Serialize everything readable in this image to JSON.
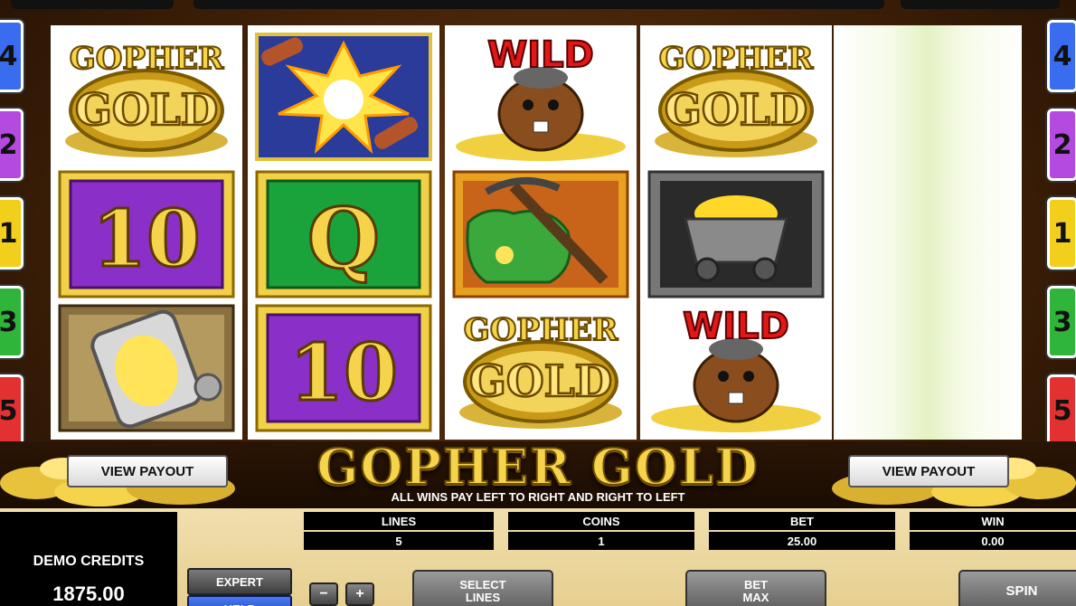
{
  "game": {
    "logo_text": "GOPHER GOLD",
    "subtitle": "ALL WINS PAY LEFT TO RIGHT AND RIGHT TO LEFT",
    "view_payout_left": "VIEW PAYOUT",
    "view_payout_right": "VIEW PAYOUT"
  },
  "line_markers": {
    "left": [
      "4",
      "2",
      "1",
      "3",
      "5"
    ],
    "right": [
      "4",
      "2",
      "1",
      "3",
      "5"
    ],
    "colors": [
      "#3a6cf0",
      "#b44ae0",
      "#f2cf1a",
      "#2fb53a",
      "#e33030"
    ]
  },
  "reels": [
    [
      "gopher-gold-logo",
      "ten",
      "lantern"
    ],
    [
      "dynamite-explosion",
      "queen",
      "ten"
    ],
    [
      "wild-gopher",
      "pickaxe-bag",
      "gopher-gold-logo"
    ],
    [
      "gopher-gold-logo",
      "gold-mine-cart",
      "wild-gopher"
    ]
  ],
  "symbols": {
    "gopher_logo_top": "GOPHER",
    "gopher_logo_bottom": "GOLD",
    "wild": "WILD",
    "ten": "10",
    "queen": "Q"
  },
  "stats": {
    "lines_label": "LINES",
    "lines_value": "5",
    "coins_label": "COINS",
    "coins_value": "1",
    "bet_label": "BET",
    "bet_value": "25.00",
    "win_label": "WIN",
    "win_value": "0.00"
  },
  "credits": {
    "label": "DEMO CREDITS",
    "value": "1875.00"
  },
  "buttons": {
    "expert": "EXPERT",
    "help": "HELP",
    "minus": "−",
    "plus": "+",
    "select_lines": "SELECT LINES",
    "bet_max": "BET MAX",
    "spin": "SPIN"
  },
  "colors": {
    "gold": "#f5d34a",
    "ten_bg": "#8b2fc9",
    "queen_bg": "#1aa33a",
    "wild_red": "#e01818"
  }
}
